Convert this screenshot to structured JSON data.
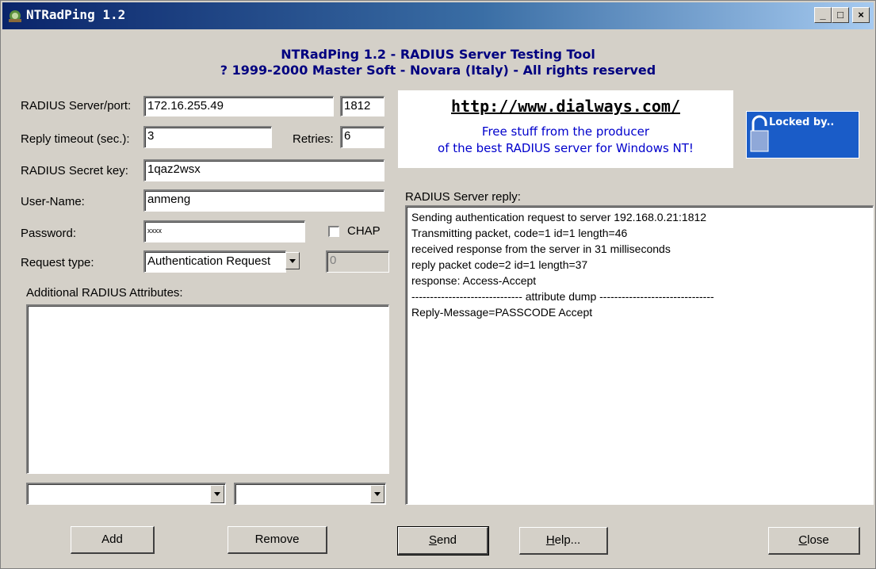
{
  "window": {
    "title": "NTRadPing 1.2"
  },
  "titlebar_buttons": {
    "minimize": "_",
    "maximize": "□",
    "close": "×"
  },
  "header": {
    "line1": "NTRadPing 1.2 - RADIUS Server Testing Tool",
    "line2": "? 1999-2000 Master Soft - Novara (Italy) - All rights reserved"
  },
  "form": {
    "server_label": "RADIUS Server/port:",
    "server_value": "172.16.255.49",
    "port_value": "1812",
    "timeout_label": "Reply timeout (sec.):",
    "timeout_value": "3",
    "retries_label": "Retries:",
    "retries_value": "6",
    "secret_label": "RADIUS Secret key:",
    "secret_value": "1qaz2wsx",
    "username_label": "User-Name:",
    "username_value": "anmeng",
    "password_label": "Password:",
    "password_value": "xxxx",
    "chap_label": "CHAP",
    "request_type_label": "Request type:",
    "request_type_value": "Authentication Request",
    "request_extra_value": "0",
    "attributes_label": "Additional RADIUS Attributes:"
  },
  "banner": {
    "url": "http://www.dialways.com/",
    "line1": "Free stuff from the producer",
    "line2": "of the best RADIUS server for Windows NT!"
  },
  "locked": {
    "text": "Locked by.."
  },
  "reply": {
    "label": "RADIUS Server reply:",
    "lines": [
      "Sending authentication request to server 192.168.0.21:1812",
      "Transmitting packet, code=1 id=1 length=46",
      "received response from the server in 31 milliseconds",
      "reply packet code=2 id=1 length=37",
      "response: Access-Accept",
      "------------------------------ attribute dump -------------------------------",
      "Reply-Message=PASSCODE Accept"
    ]
  },
  "buttons": {
    "add": "Add",
    "remove": "Remove",
    "send_u": "S",
    "send_rest": "end",
    "help_u": "H",
    "help_rest": "elp...",
    "close_u": "C",
    "close_rest": "lose"
  }
}
